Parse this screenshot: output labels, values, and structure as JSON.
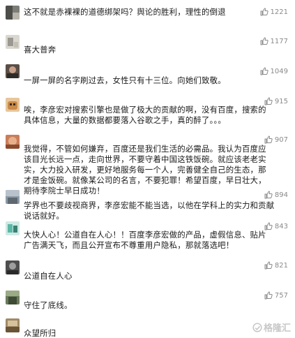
{
  "comments": [
    {
      "text": "这不就是赤裸裸的道德绑架吗？舆论的胜利，理性的倒退",
      "likes": "1221"
    },
    {
      "text": "喜大普奔",
      "likes": "1177"
    },
    {
      "text": "一屏一屏的名字刷过去，女性只有十三位。向她们致敬。",
      "likes": "1049"
    },
    {
      "text": "唉，李彦宏对搜索引擎也是做了极大的贡献的啊，没有百度，搜索的具体信息，大量的数据都要落入谷歌之手，真的醉了。。。",
      "likes": "915"
    },
    {
      "text": "我觉得，不管如何嫌弃，百度还是我们生活的必需品。我认为百度应该目光长远一点，走向世界，不要守着中国这铁饭碗。就应该老老实实，大力投入研发，更好地服务每一个人，完善健全自己的生态，那才是金饭碗。就像某公司的名言，不要犯罪！希望百度，早日壮大，期待李院士早日成功！",
      "likes": "907"
    },
    {
      "text": "学界也不要歧视商界，李彦宏能不能当选，以他在学科上的实力和贡献说话就好。",
      "likes": "894"
    },
    {
      "text": "大快人心！公道自在人心！！百度李彦宏做的产品，虚假信息、贴片广告满天飞，而且公开宣布不尊重用户隐私，那就落选吧！",
      "likes": "843"
    },
    {
      "text": "公道自在人心",
      "likes": "821"
    },
    {
      "text": "守住了底线。",
      "likes": "757"
    },
    {
      "text": "众望所归",
      "likes": ""
    }
  ],
  "watermark": {
    "text": "格隆汇"
  },
  "colors": {
    "like_icon": "#8a8a8a",
    "text": "#1a1a1a"
  }
}
